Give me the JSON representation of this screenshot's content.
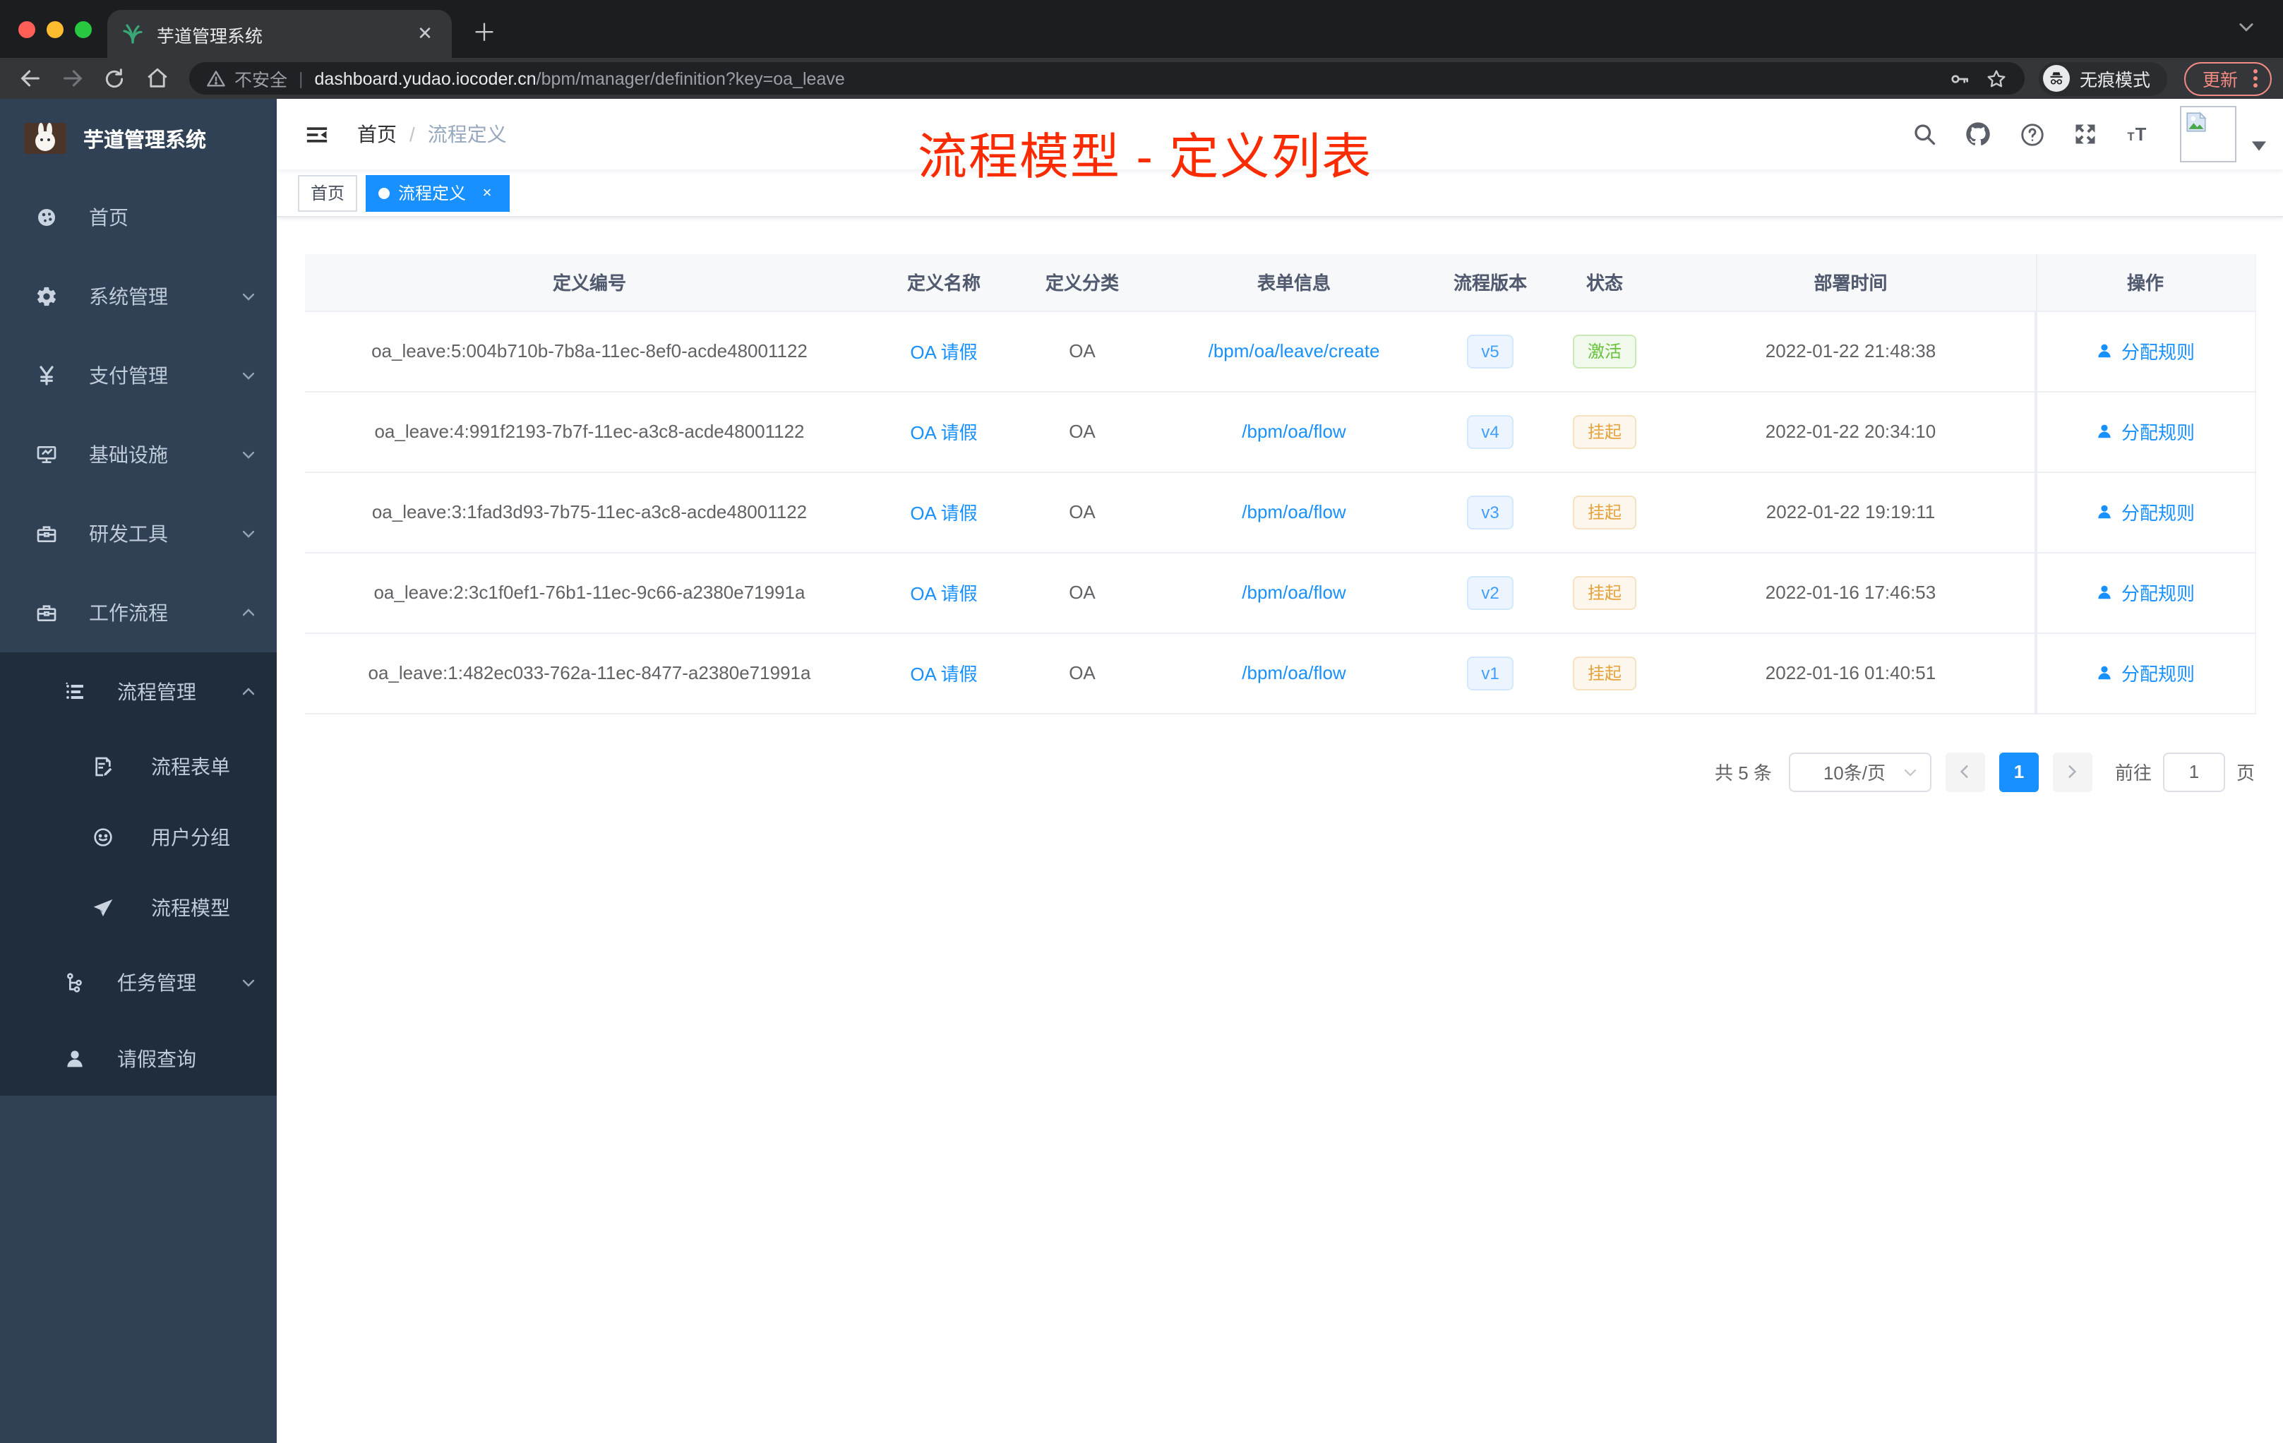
{
  "browser": {
    "tab": {
      "title": "芋道管理系统"
    },
    "address": {
      "security_label": "不安全",
      "host": "dashboard.yudao.iocoder.cn",
      "path": "/bpm/manager/definition?key=oa_leave"
    },
    "incognito_label": "无痕模式",
    "update_label": "更新"
  },
  "sidebar": {
    "logo_title": "芋道管理系统",
    "items": [
      {
        "label": "首页"
      },
      {
        "label": "系统管理"
      },
      {
        "label": "支付管理"
      },
      {
        "label": "基础设施"
      },
      {
        "label": "研发工具"
      },
      {
        "label": "工作流程"
      },
      {
        "label": "流程管理"
      },
      {
        "label": "流程表单"
      },
      {
        "label": "用户分组"
      },
      {
        "label": "流程模型"
      },
      {
        "label": "任务管理"
      },
      {
        "label": "请假查询"
      }
    ]
  },
  "navbar": {
    "breadcrumb": {
      "home": "首页",
      "separator": "/",
      "current": "流程定义"
    }
  },
  "annotation": "流程模型 - 定义列表",
  "tags": {
    "home": "首页",
    "active": "流程定义",
    "close": "×"
  },
  "table": {
    "columns": [
      "定义编号",
      "定义名称",
      "定义分类",
      "表单信息",
      "流程版本",
      "状态",
      "部署时间",
      "操作"
    ],
    "rows": [
      {
        "id": "oa_leave:5:004b710b-7b8a-11ec-8ef0-acde48001122",
        "name": "OA 请假",
        "category": "OA",
        "form": "/bpm/oa/leave/create",
        "version": "v5",
        "status": "激活",
        "status_type": "success",
        "time": "2022-01-22 21:48:38",
        "action": "分配规则"
      },
      {
        "id": "oa_leave:4:991f2193-7b7f-11ec-a3c8-acde48001122",
        "name": "OA 请假",
        "category": "OA",
        "form": "/bpm/oa/flow",
        "version": "v4",
        "status": "挂起",
        "status_type": "warning",
        "time": "2022-01-22 20:34:10",
        "action": "分配规则"
      },
      {
        "id": "oa_leave:3:1fad3d93-7b75-11ec-a3c8-acde48001122",
        "name": "OA 请假",
        "category": "OA",
        "form": "/bpm/oa/flow",
        "version": "v3",
        "status": "挂起",
        "status_type": "warning",
        "time": "2022-01-22 19:19:11",
        "action": "分配规则"
      },
      {
        "id": "oa_leave:2:3c1f0ef1-76b1-11ec-9c66-a2380e71991a",
        "name": "OA 请假",
        "category": "OA",
        "form": "/bpm/oa/flow",
        "version": "v2",
        "status": "挂起",
        "status_type": "warning",
        "time": "2022-01-16 17:46:53",
        "action": "分配规则"
      },
      {
        "id": "oa_leave:1:482ec033-762a-11ec-8477-a2380e71991a",
        "name": "OA 请假",
        "category": "OA",
        "form": "/bpm/oa/flow",
        "version": "v1",
        "status": "挂起",
        "status_type": "warning",
        "time": "2022-01-16 01:40:51",
        "action": "分配规则"
      }
    ]
  },
  "pagination": {
    "total": "共 5 条",
    "page_size": "10条/页",
    "prev": "‹",
    "next": "›",
    "page": "1",
    "goto": "前往",
    "goto_value": "1",
    "unit": "页"
  }
}
